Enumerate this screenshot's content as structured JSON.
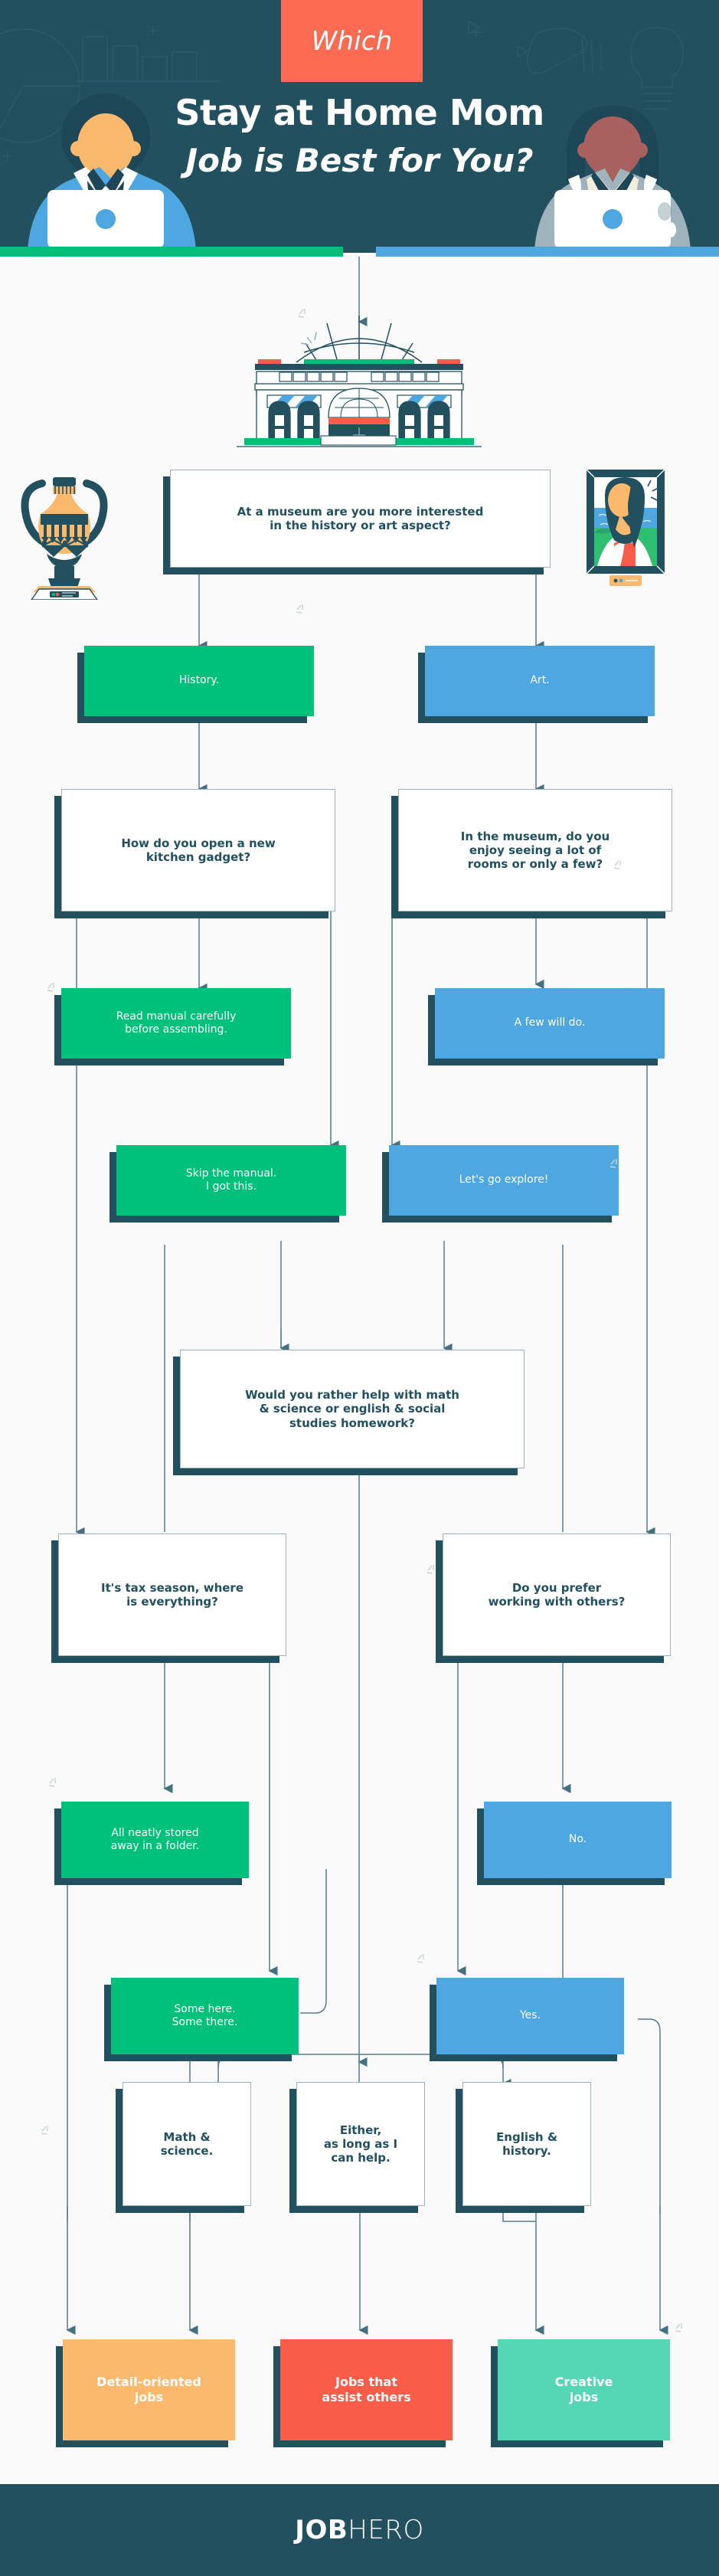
{
  "header": {
    "badge": "Which",
    "title": "Stay at Home Mom",
    "subtitle": "Job is Best for You?",
    "colors": {
      "bg": "#22505f",
      "badge": "#fd6a52",
      "green": "#00bf79",
      "blue": "#4ea7e0"
    },
    "illustrations": [
      {
        "name": "woman-at-laptop-left",
        "skin": "#fbb96e",
        "hair": "#1d4656",
        "jacket": "#4ea7e0"
      },
      {
        "name": "woman-at-laptop-right",
        "skin": "#a9615f",
        "hair": "#1d4656",
        "jacket": "#9fb3bc"
      }
    ]
  },
  "flow": {
    "illustrations": {
      "museum": "museum-building",
      "vase": "greek-vase-on-pedestal",
      "painting": "framed-portrait-painting"
    },
    "nodes": [
      {
        "id": "q1",
        "kind": "question",
        "text": "At a museum are you more interested in the history or art aspect?"
      },
      {
        "id": "a1a",
        "kind": "answer-green",
        "text": "History."
      },
      {
        "id": "a1b",
        "kind": "answer-blue",
        "text": "Art."
      },
      {
        "id": "q2",
        "kind": "question",
        "text": "How do you open a new kitchen gadget?"
      },
      {
        "id": "q3",
        "kind": "question",
        "text": "In the museum, do you enjoy seeing a lot of rooms or only a few?"
      },
      {
        "id": "a2a",
        "kind": "answer-green",
        "text": "Read manual carefully before assembling."
      },
      {
        "id": "a3a",
        "kind": "answer-blue",
        "text": "A few will do."
      },
      {
        "id": "a2b",
        "kind": "answer-green",
        "text": "Skip the manual. I got this."
      },
      {
        "id": "a3b",
        "kind": "answer-blue",
        "text": "Let's go explore!"
      },
      {
        "id": "q4",
        "kind": "question",
        "text": "Would you rather help with math & science or english & social studies homework?"
      },
      {
        "id": "q5",
        "kind": "question",
        "text": "It's tax season, where is everything?"
      },
      {
        "id": "q6",
        "kind": "question",
        "text": "Do you prefer working with others?"
      },
      {
        "id": "a5a",
        "kind": "answer-green",
        "text": "All neatly stored away in a folder."
      },
      {
        "id": "a6a",
        "kind": "answer-blue",
        "text": "No."
      },
      {
        "id": "a5b",
        "kind": "answer-green",
        "text": "Some here. Some there."
      },
      {
        "id": "a6b",
        "kind": "answer-blue",
        "text": "Yes."
      },
      {
        "id": "q7",
        "kind": "question",
        "text": "Math & science."
      },
      {
        "id": "q8",
        "kind": "question",
        "text": "Either, as long as I can help."
      },
      {
        "id": "q9",
        "kind": "question",
        "text": "English & history."
      },
      {
        "id": "r1",
        "kind": "result-orange",
        "text": "Detail-oriented jobs"
      },
      {
        "id": "r2",
        "kind": "result-red",
        "text": "Jobs that assist others"
      },
      {
        "id": "r3",
        "kind": "result-teal",
        "text": "Creative jobs"
      }
    ],
    "node_text": {
      "q1_l1": "At a museum are you more interested",
      "q1_l2": "in the history or art aspect?",
      "a1a": "History.",
      "a1b": "Art.",
      "q2_l1": "How do you open a new",
      "q2_l2": "kitchen gadget?",
      "q3_l1": "In the museum, do you",
      "q3_l2": "enjoy seeing a lot of",
      "q3_l3": "rooms or only a few?",
      "a2a_l1": "Read manual carefully",
      "a2a_l2": "before assembling.",
      "a3a": "A few will do.",
      "a2b_l1": "Skip the manual.",
      "a2b_l2": "I got this.",
      "a3b": "Let's go explore!",
      "q4_l1": "Would you rather help with math",
      "q4_l2": "& science or english & social",
      "q4_l3": "studies homework?",
      "q5_l1": "It's tax season, where",
      "q5_l2": "is everything?",
      "q6_l1": "Do you prefer",
      "q6_l2": "working with others?",
      "a5a_l1": "All neatly stored",
      "a5a_l2": "away in a folder.",
      "a6a": "No.",
      "a5b_l1": "Some here.",
      "a5b_l2": "Some there.",
      "a6b": "Yes.",
      "q7_l1": "Math &",
      "q7_l2": "science.",
      "q8_l1": "Either,",
      "q8_l2": "as long as I",
      "q8_l3": "can help.",
      "q9_l1": "English &",
      "q9_l2": "history.",
      "r1_l1": "Detail-oriented",
      "r1_l2": "jobs",
      "r2_l1": "Jobs that",
      "r2_l2": "assist others",
      "r3_l1": "Creative",
      "r3_l2": "jobs"
    },
    "colors": {
      "question_bg": "#ffffff",
      "question_text": "#22505f",
      "green": "#00c17c",
      "blue": "#4ea7e0",
      "orange": "#fbb96e",
      "red": "#fa5c4a",
      "teal": "#55d6b4",
      "shadow": "#22505f",
      "line": "#5b7c8a",
      "page_bg": "#fafafa"
    }
  },
  "footer": {
    "logo_bold": "JOB",
    "logo_light": "HERO",
    "bg": "#22505f"
  }
}
